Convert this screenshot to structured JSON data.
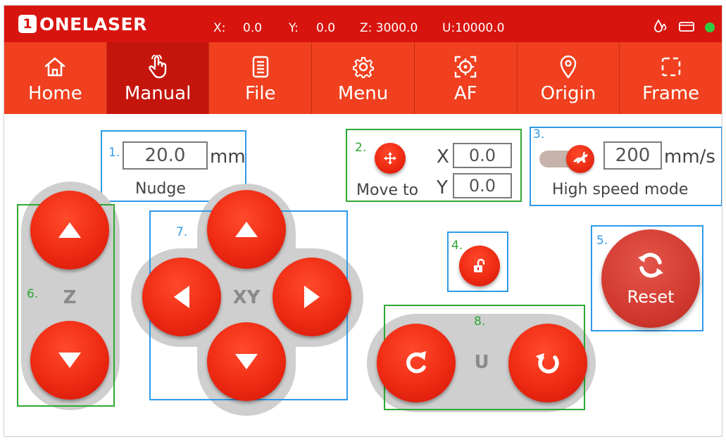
{
  "status": {
    "logo_mark": "1",
    "logo_text": "ONELASER",
    "x_label": "X:",
    "x_value": "0.0",
    "y_label": "Y:",
    "y_value": "0.0",
    "z_text": "Z: 3000.0",
    "u_text": "U:10000.0",
    "icons": [
      "water-drop-icon",
      "card-icon",
      "online-dot-icon"
    ],
    "online_color": "#2ecc40"
  },
  "toolbar": {
    "items": [
      {
        "label": "Home",
        "icon": "home-icon"
      },
      {
        "label": "Manual",
        "icon": "hand-pointer-icon",
        "active": true
      },
      {
        "label": "File",
        "icon": "file-list-icon"
      },
      {
        "label": "Menu",
        "icon": "gear-icon"
      },
      {
        "label": "AF",
        "icon": "autofocus-icon"
      },
      {
        "label": "Origin",
        "icon": "location-pin-icon"
      },
      {
        "label": "Frame",
        "icon": "dashed-frame-icon"
      }
    ]
  },
  "nudge": {
    "number": "1.",
    "value": "20.0",
    "unit": "mm",
    "label": "Nudge"
  },
  "move_to": {
    "number": "2.",
    "label": "Move to",
    "x_label": "X",
    "x_value": "0.0",
    "y_label": "Y",
    "y_value": "0.0"
  },
  "speed": {
    "number": "3.",
    "value": "200",
    "unit": "mm/s",
    "label": "High speed mode"
  },
  "lock": {
    "number": "4."
  },
  "reset": {
    "number": "5.",
    "label": "Reset"
  },
  "z_pad": {
    "number": "6.",
    "label": "Z"
  },
  "xy_pad": {
    "number": "7.",
    "label": "XY"
  },
  "u_pad": {
    "number": "8.",
    "label": "U"
  },
  "colors": {
    "brand_red": "#d8140f",
    "toolbar_orange": "#f0401f",
    "annotation_blue": "#2e9ae8",
    "annotation_green": "#2fa832"
  }
}
